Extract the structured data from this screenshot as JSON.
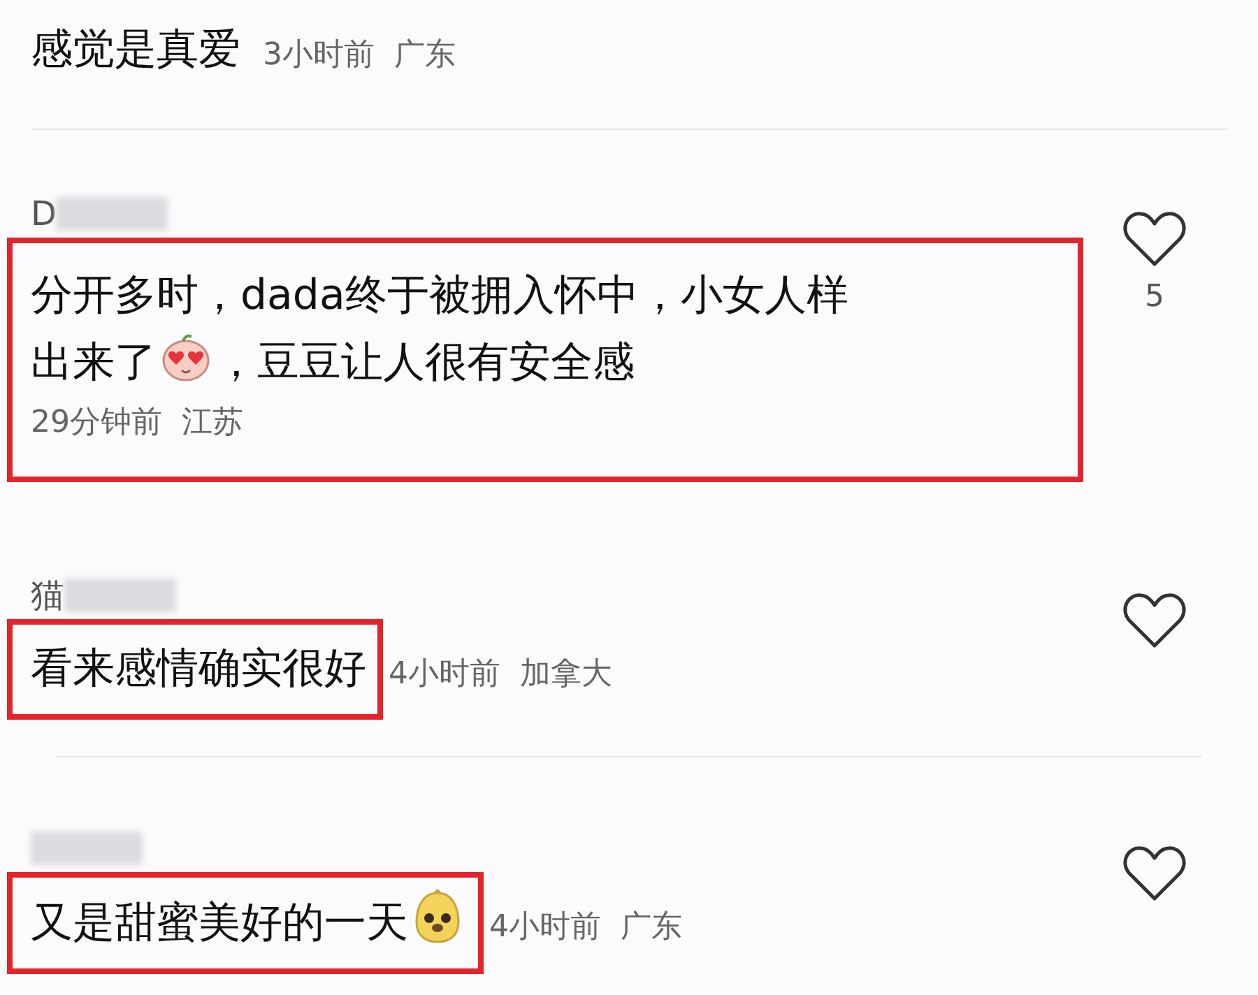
{
  "comments": [
    {
      "kind": "plain",
      "content": [
        {
          "kind": "text",
          "text": "感觉是真爱"
        }
      ],
      "time": "3小时前",
      "region": "广东",
      "username_blurred": false,
      "like_button": false
    },
    {
      "kind": "framedblock",
      "username": "D",
      "username_blurred": true,
      "content": [
        {
          "kind": "text",
          "text": "分开多时，dada终于被拥入怀中，小女人样出来了"
        },
        {
          "kind": "lovesticker"
        },
        {
          "kind": "text",
          "text": "，豆豆让人很有安全感"
        }
      ],
      "time": "29分钟前",
      "region": "江苏",
      "like_button": true,
      "like_count": "5"
    },
    {
      "kind": "framedtext",
      "username": "猫",
      "username_blurred": true,
      "content": [
        {
          "kind": "text",
          "text": "看来感情确实很好"
        }
      ],
      "time": "4小时前",
      "region": "加拿大",
      "like_button": true
    },
    {
      "kind": "framedtext",
      "username_blurred": true,
      "content": [
        {
          "kind": "text",
          "text": "又是甜蜜美好的一天"
        },
        {
          "kind": "dogsticker"
        }
      ],
      "time": "4小时前",
      "region": "广东",
      "like_button": true
    }
  ]
}
